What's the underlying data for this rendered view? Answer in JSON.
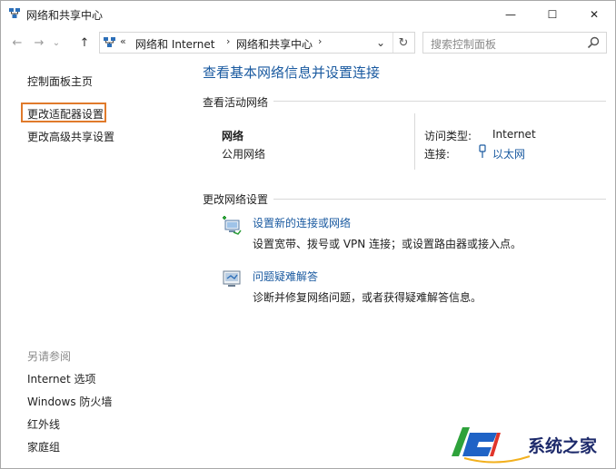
{
  "window": {
    "title": "网络和共享中心",
    "controls": {
      "minimize": "—",
      "maximize": "☐",
      "close": "✕"
    }
  },
  "nav": {
    "back": "←",
    "forward": "→",
    "recent": "⌄",
    "up": "↑",
    "breadcrumb_overflow": "«",
    "breadcrumbs": [
      "网络和 Internet",
      "网络和共享中心"
    ],
    "separator": "›",
    "dropdown": "⌄",
    "refresh": "↻",
    "search_placeholder": "搜索控制面板"
  },
  "sidebar": {
    "home": "控制面板主页",
    "change_adapter": "更改适配器设置",
    "change_advanced": "更改高级共享设置",
    "see_also_label": "另请参阅",
    "see_also": [
      "Internet 选项",
      "Windows 防火墙",
      "红外线",
      "家庭组"
    ]
  },
  "main": {
    "title": "查看基本网络信息并设置连接",
    "active_section": "查看活动网络",
    "network": {
      "name": "网络",
      "type": "公用网络",
      "access_label": "访问类型:",
      "access_value": "Internet",
      "connections_label": "连接:",
      "connections_value": "以太网"
    },
    "change_section": "更改网络设置",
    "tasks": [
      {
        "link": "设置新的连接或网络",
        "desc": "设置宽带、拨号或 VPN 连接；或设置路由器或接入点。"
      },
      {
        "link": "问题疑难解答",
        "desc": "诊断并修复网络问题，或者获得疑难解答信息。"
      }
    ]
  },
  "watermark": {
    "text": "系统之家"
  },
  "colors": {
    "link": "#1a5aa0",
    "highlight_box": "#e07a2b",
    "watermark_blue": "#1f63c6"
  }
}
